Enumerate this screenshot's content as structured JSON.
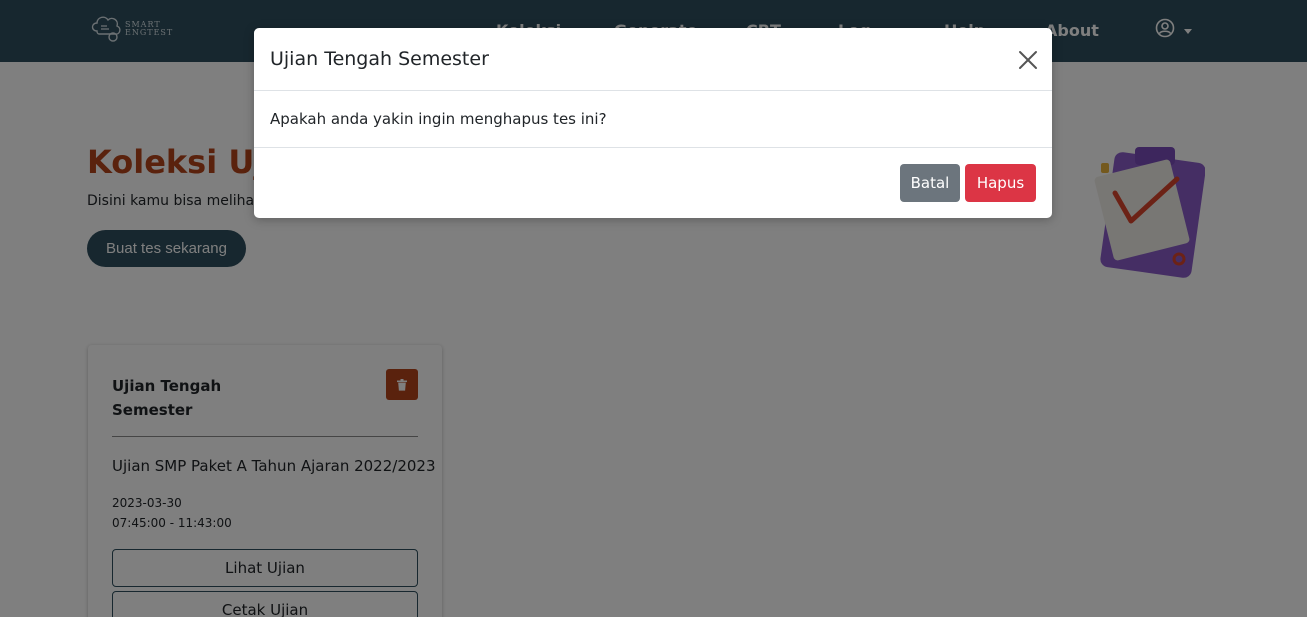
{
  "brand": {
    "name": "SMART ENGTEST"
  },
  "nav": {
    "items": [
      {
        "label": "Koleksi"
      },
      {
        "label": "Generate"
      },
      {
        "label": "CBT"
      },
      {
        "label": "Log"
      },
      {
        "label": "Help"
      },
      {
        "label": "About"
      }
    ]
  },
  "user_menu": {
    "icon": "user-circle-icon"
  },
  "hero": {
    "title": "Koleksi Ujian",
    "subtitle": "Disini kamu bisa melihat koleksi ujian",
    "create_button": "Buat tes sekarang",
    "illustration": "clipboard-check-icon"
  },
  "exam_card": {
    "title": "Ujian Tengah Semester",
    "description": "Ujian SMP Paket A Tahun Ajaran 2022/2023",
    "date": "2023-03-30",
    "time": "07:45:00 - 11:43:00",
    "view_button": "Lihat Ujian",
    "print_button": "Cetak Ujian",
    "delete_icon": "trash-icon"
  },
  "modal": {
    "title": "Ujian Tengah Semester",
    "body": "Apakah anda yakin ingin menghapus tes ini?",
    "cancel_label": "Batal",
    "confirm_label": "Hapus"
  },
  "colors": {
    "navbar": "#2f4f5e",
    "accent": "#b5451b",
    "danger": "#dc3545",
    "secondary": "#6c757d"
  }
}
